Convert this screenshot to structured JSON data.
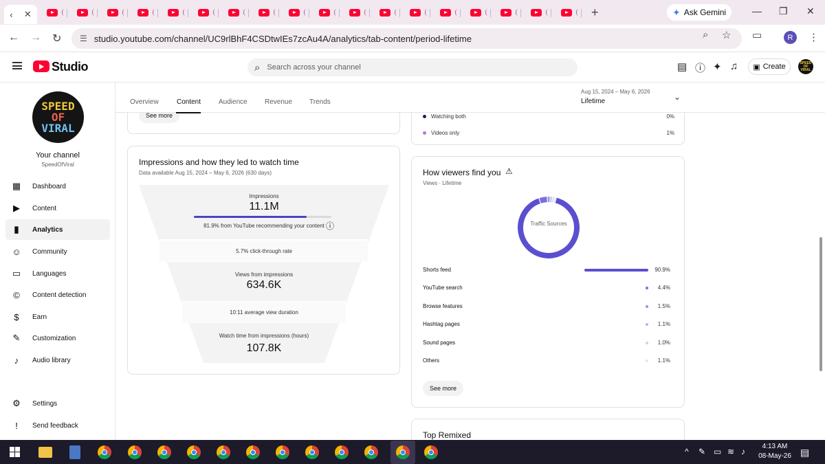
{
  "browser": {
    "active_tab_label": "YouTube Studio",
    "tab_count_visible": 19,
    "ask_gemini": "Ask Gemini",
    "url": "studio.youtube.com/channel/UC9rlBhF4CSDtwIEs7zcAu4A/analytics/tab-content/period-lifetime",
    "profile_initial": "R"
  },
  "studio": {
    "logo_text": "Studio",
    "search_placeholder": "Search across your channel",
    "create_label": "Create",
    "channel_avatar_text": "SPEED OF VIRAL"
  },
  "sidebar": {
    "avatar_lines": [
      "SPEED",
      "OF",
      "VIRAL"
    ],
    "your_channel": "Your channel",
    "channel_handle": "SpeedOfViral",
    "items": [
      {
        "label": "Dashboard",
        "icon": "dashboard-icon",
        "active": false
      },
      {
        "label": "Content",
        "icon": "content-icon",
        "active": false
      },
      {
        "label": "Analytics",
        "icon": "analytics-icon",
        "active": true
      },
      {
        "label": "Community",
        "icon": "community-icon",
        "active": false
      },
      {
        "label": "Languages",
        "icon": "languages-icon",
        "active": false
      },
      {
        "label": "Content detection",
        "icon": "content-detection-icon",
        "active": false
      },
      {
        "label": "Earn",
        "icon": "earn-icon",
        "active": false
      },
      {
        "label": "Customization",
        "icon": "customization-icon",
        "active": false
      },
      {
        "label": "Audio library",
        "icon": "audio-library-icon",
        "active": false
      }
    ],
    "settings": "Settings",
    "feedback": "Send feedback"
  },
  "analytics": {
    "tabs": [
      "Overview",
      "Content",
      "Audience",
      "Revenue",
      "Trends"
    ],
    "active_tab": "Content",
    "period_range": "Aug 15, 2024 – May 6, 2026",
    "period_label": "Lifetime"
  },
  "top_card": {
    "see_more": "See more"
  },
  "watching_card": {
    "rows": [
      {
        "label": "Watching both",
        "value": "0%",
        "color": "#1f1a5c"
      },
      {
        "label": "Videos only",
        "value": "1%",
        "color": "#b07ad6"
      }
    ]
  },
  "impressions_card": {
    "title": "Impressions and how they led to watch time",
    "subtitle": "Data available Aug 15, 2024 – May 6, 2026 (630 days)",
    "impressions_label": "Impressions",
    "impressions_value": "11.1M",
    "impressions_bar_fraction": 0.819,
    "impressions_note": "81.9% from YouTube recommending your content",
    "ctr": "5.7% click-through rate",
    "views_label": "Views from impressions",
    "views_value": "634.6K",
    "avg_duration": "10:11 average view duration",
    "watch_label": "Watch time from impressions (hours)",
    "watch_value": "107.8K"
  },
  "viewers_card": {
    "title": "How viewers find you",
    "subtitle": "Views · Lifetime",
    "donut_label": "Traffic Sources",
    "see_more": "See more",
    "sources": [
      {
        "label": "Shorts feed",
        "value": "90.9%",
        "pct": 90.9,
        "color": "#5b4fd0"
      },
      {
        "label": "YouTube search",
        "value": "4.4%",
        "pct": 4.4,
        "color": "#7b6fdc"
      },
      {
        "label": "Browse features",
        "value": "1.5%",
        "pct": 1.5,
        "color": "#9a90e4"
      },
      {
        "label": "Hashtag pages",
        "value": "1.1%",
        "pct": 1.1,
        "color": "#b8b1ec"
      },
      {
        "label": "Sound pages",
        "value": "1.0%",
        "pct": 1.0,
        "color": "#d2cdf3"
      },
      {
        "label": "Others",
        "value": "1.1%",
        "pct": 1.1,
        "color": "#e4e1f7"
      }
    ]
  },
  "remixed_card": {
    "title": "Top Remixed"
  },
  "taskbar": {
    "time": "4:13 AM",
    "date": "08-May-26"
  }
}
